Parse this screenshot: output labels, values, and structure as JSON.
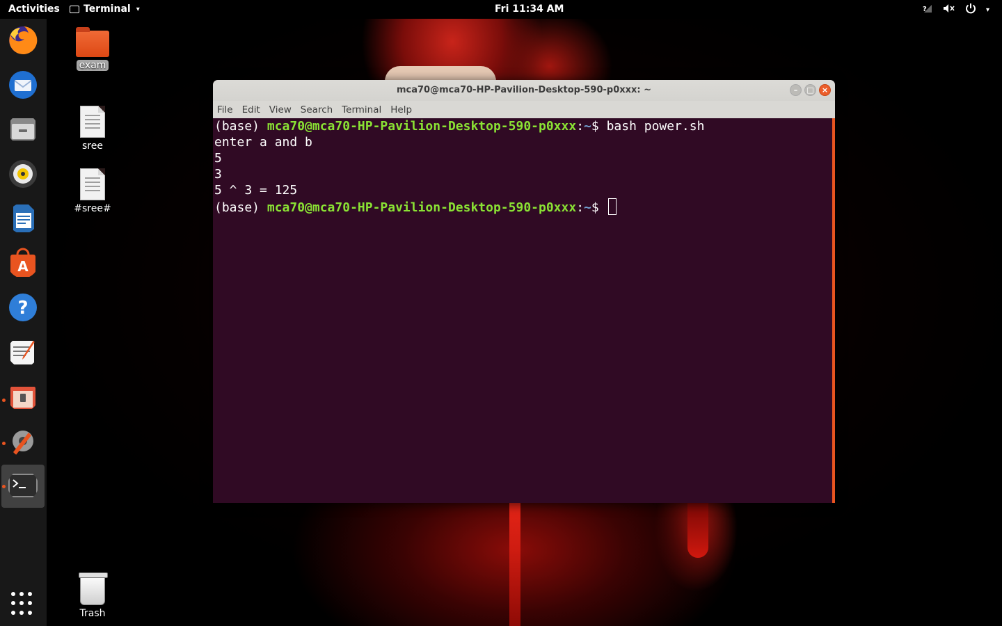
{
  "topbar": {
    "activities": "Activities",
    "app_name": "Terminal",
    "clock": "Fri 11:34 AM",
    "tray_icons": [
      "network-icon",
      "volume-muted-icon",
      "power-icon",
      "menu-caret-icon"
    ]
  },
  "dock": {
    "items": [
      "firefox-icon",
      "thunderbird-icon",
      "files-icon",
      "rhythmbox-icon",
      "libreoffice-writer-icon",
      "ubuntu-software-icon",
      "help-icon",
      "text-editor-icon",
      "file-roller-icon",
      "settings-tool-icon",
      "terminal-icon"
    ],
    "show_apps": "show-applications-icon"
  },
  "desktop": {
    "icons": [
      {
        "label": "exam",
        "type": "folder"
      },
      {
        "label": "sree",
        "type": "document"
      },
      {
        "label": "#sree#",
        "type": "document"
      },
      {
        "label": "Trash",
        "type": "trash"
      }
    ]
  },
  "window": {
    "title": "mca70@mca70-HP-Pavilion-Desktop-590-p0xxx: ~",
    "menu": [
      "File",
      "Edit",
      "View",
      "Search",
      "Terminal",
      "Help"
    ]
  },
  "terminal": {
    "prompt_prefix": "(base) ",
    "user_host": "mca70@mca70-HP-Pavilion-Desktop-590-p0xxx",
    "colon": ":",
    "path": "~",
    "dollar": "$ ",
    "command": "bash power.sh",
    "output": [
      "enter a and b",
      "5",
      "3",
      "5 ^ 3 = 125"
    ]
  },
  "colors": {
    "terminal_bg": "#300a24",
    "user_host": "#8ae234",
    "path": "#729fcf",
    "accent": "#e95420"
  }
}
